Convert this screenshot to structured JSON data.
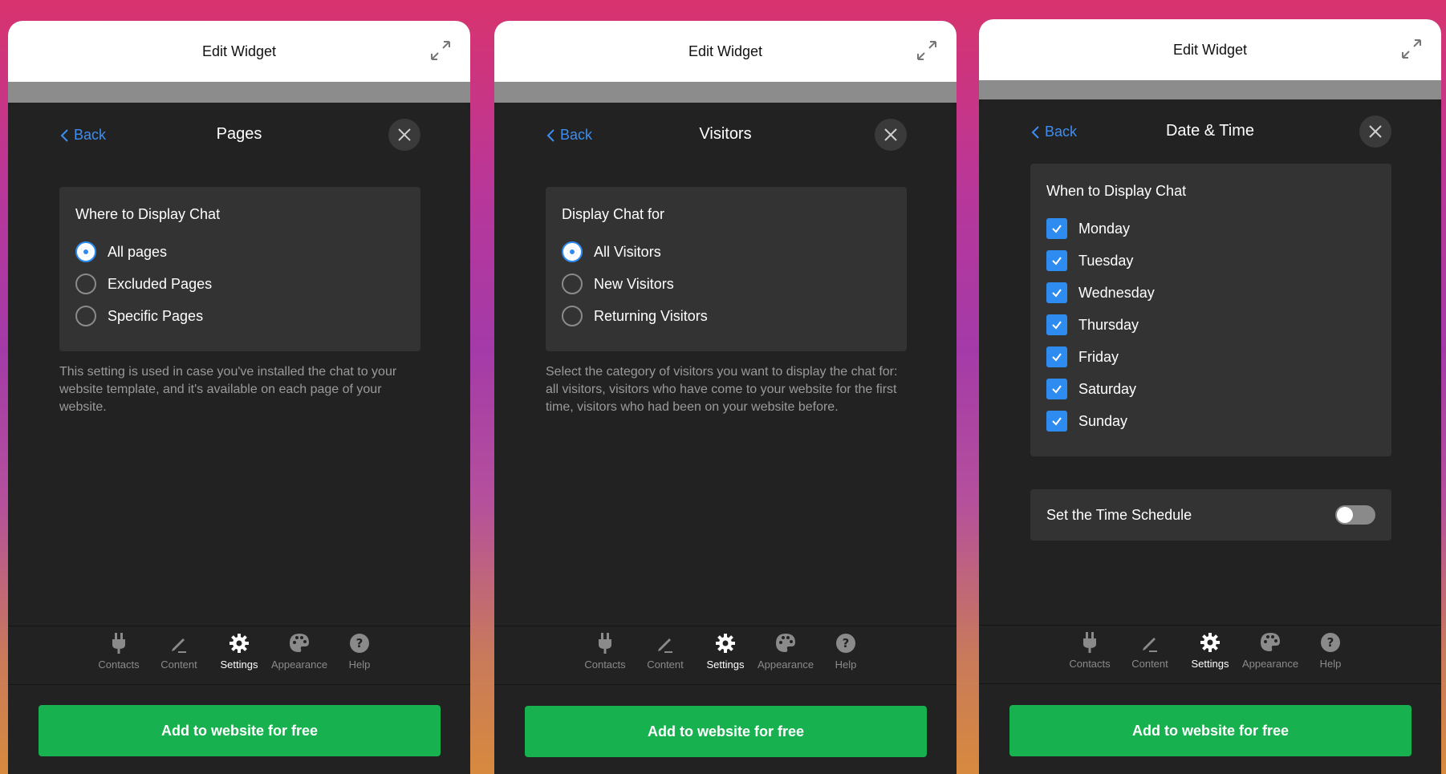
{
  "colors": {
    "accent": "#2e8cf0",
    "cta": "#17b24f",
    "sheet": "#222222",
    "card": "#333333"
  },
  "panels": [
    {
      "header_title": "Edit Widget",
      "back_label": "Back",
      "title": "Pages",
      "card_label": "Where to Display Chat",
      "options": [
        "All pages",
        "Excluded Pages",
        "Specific Pages"
      ],
      "selected": "All pages",
      "help": "This setting is used in case you've installed the chat to your website template, and it's available on each page of your website.",
      "cta": "Add to website for free"
    },
    {
      "header_title": "Edit Widget",
      "back_label": "Back",
      "title": "Visitors",
      "card_label": "Display Chat for",
      "options": [
        "All Visitors",
        "New Visitors",
        "Returning Visitors"
      ],
      "selected": "All Visitors",
      "help": "Select the category of visitors you want to display the chat for: all visitors, visitors who have come to your website for the first time, visitors who had been on your website before.",
      "cta": "Add to website for free"
    },
    {
      "header_title": "Edit Widget",
      "back_label": "Back",
      "title": "Date & Time",
      "card_label": "When to Display Chat",
      "days": [
        "Monday",
        "Tuesday",
        "Wednesday",
        "Thursday",
        "Friday",
        "Saturday",
        "Sunday"
      ],
      "days_checked": true,
      "schedule_label": "Set the Time Schedule",
      "schedule_on": false,
      "cta": "Add to website for free"
    }
  ],
  "tabs": [
    {
      "label": "Contacts",
      "icon": "plug-icon"
    },
    {
      "label": "Content",
      "icon": "pen-icon"
    },
    {
      "label": "Settings",
      "icon": "gear-icon",
      "active": true
    },
    {
      "label": "Appearance",
      "icon": "palette-icon"
    },
    {
      "label": "Help",
      "icon": "help-icon"
    }
  ]
}
